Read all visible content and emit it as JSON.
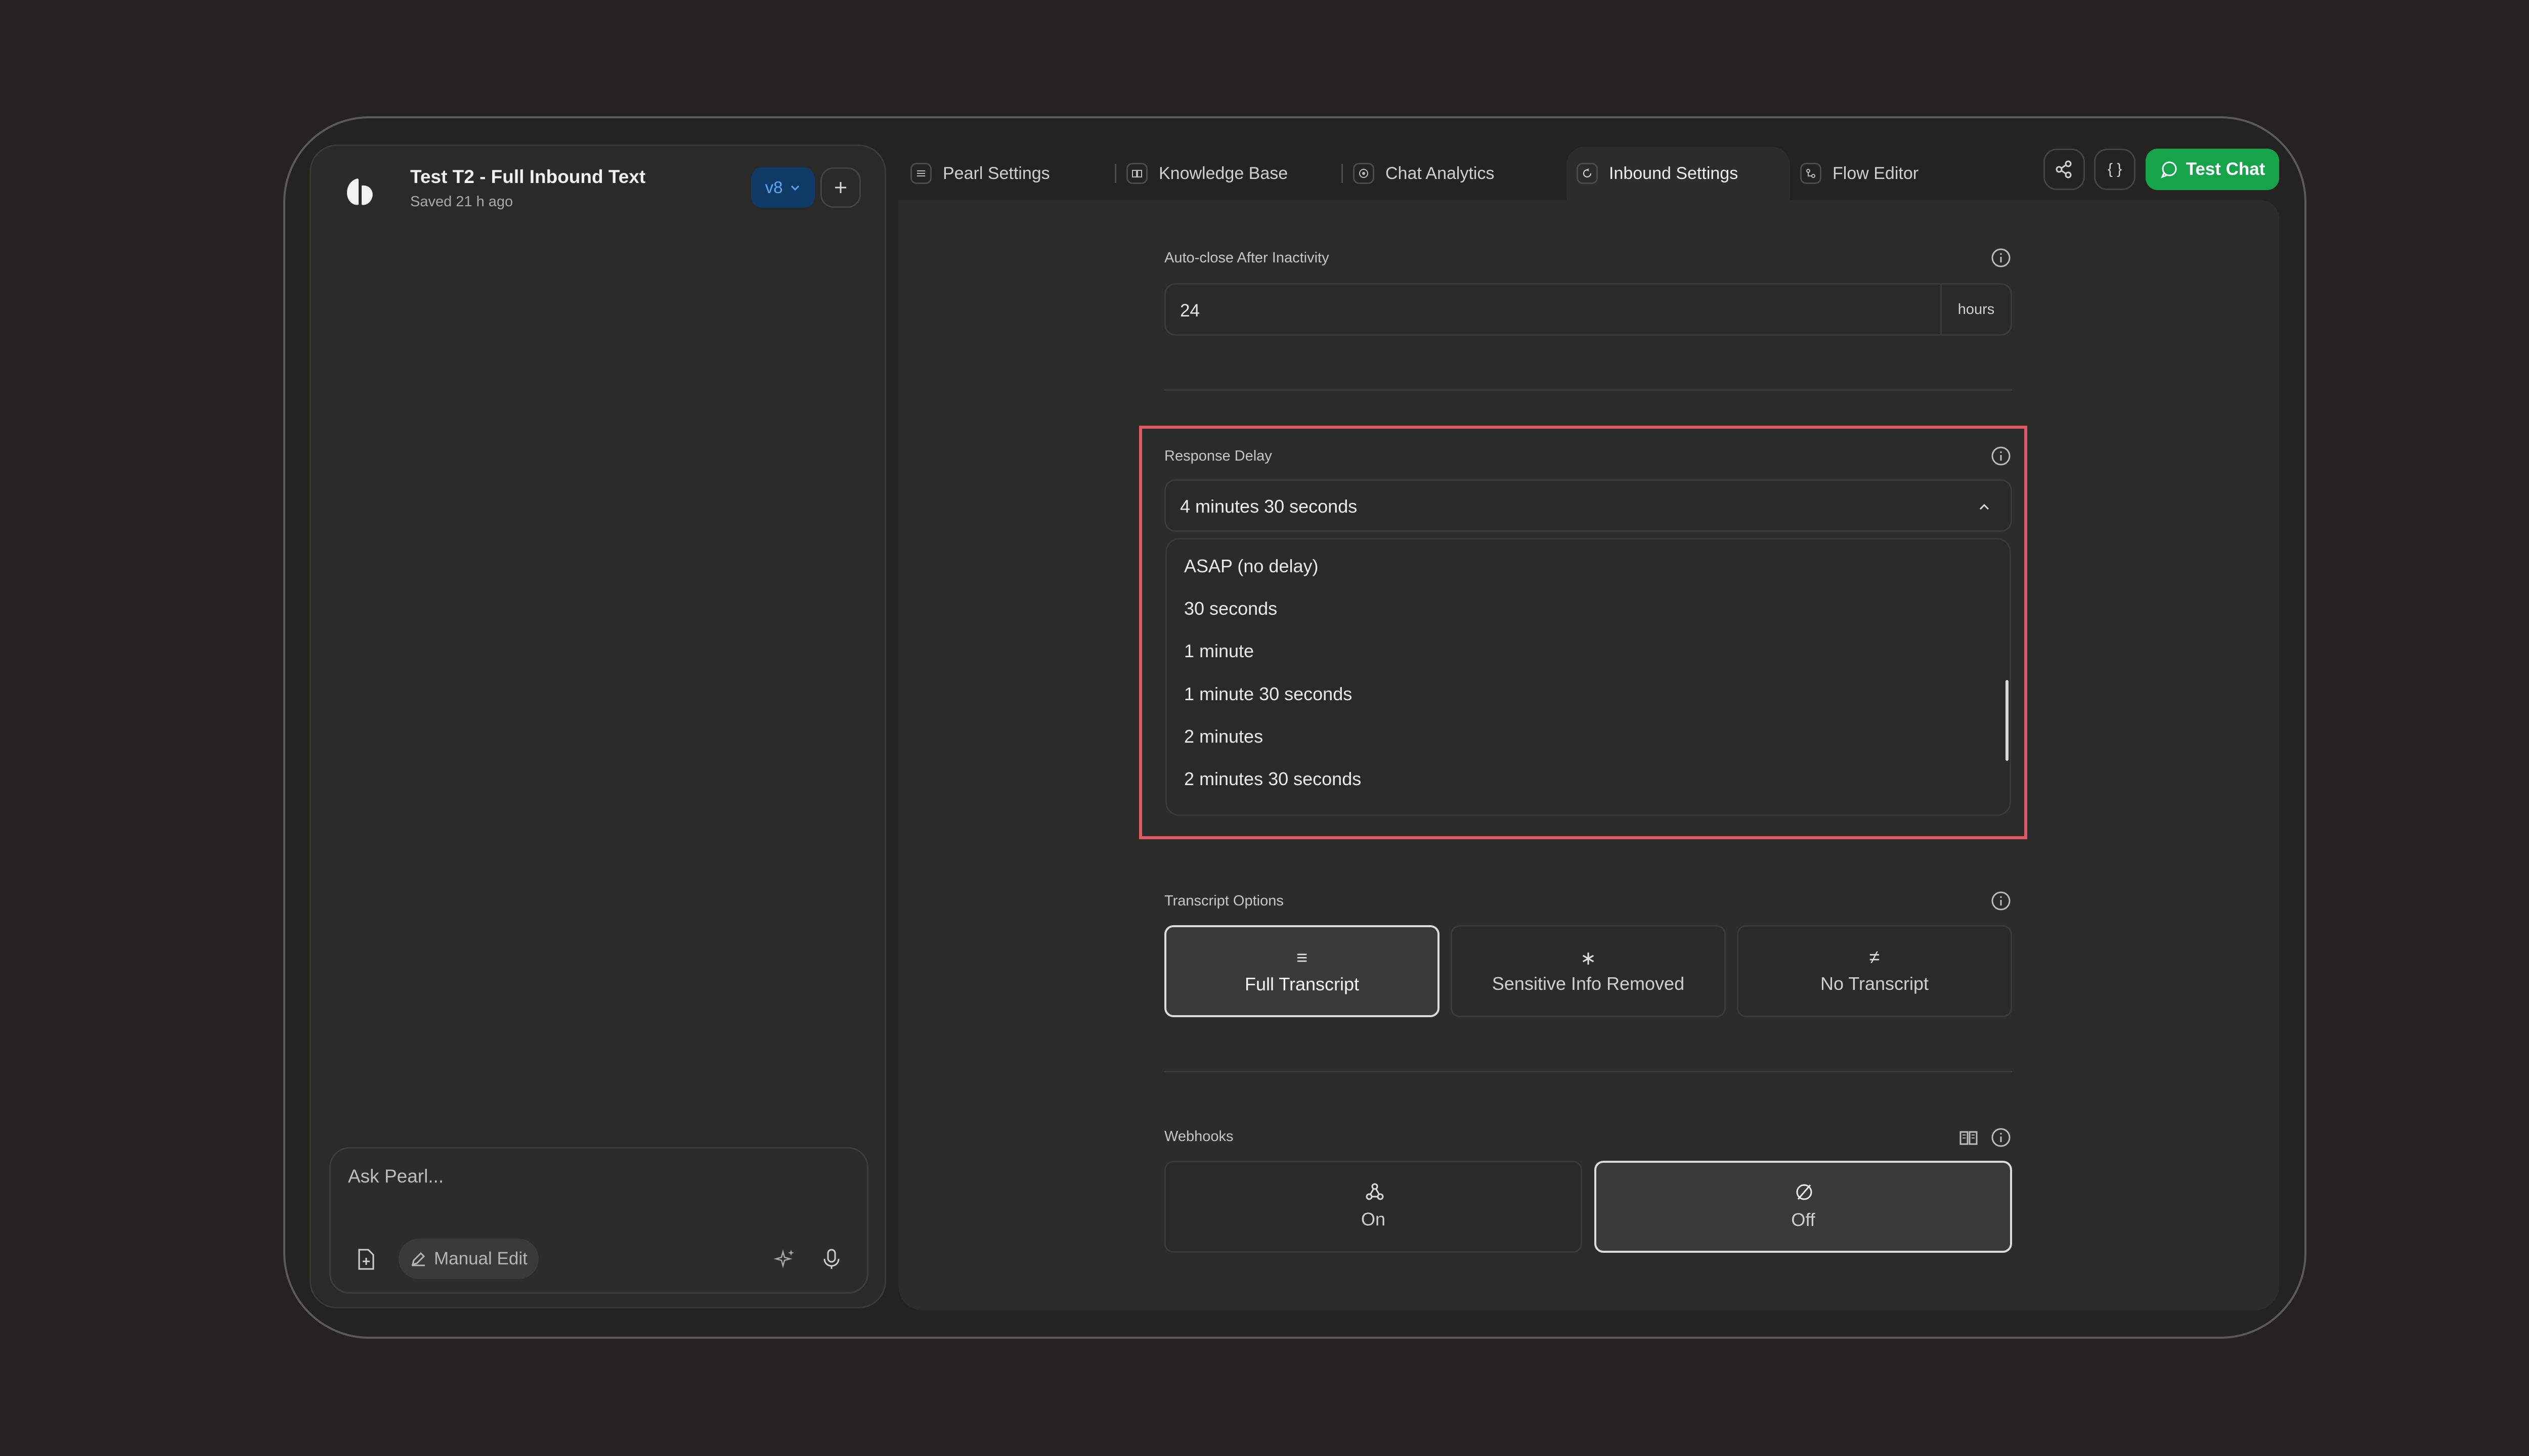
{
  "project": {
    "title": "Test T2 - Full Inbound Text",
    "saved": "Saved 21 h ago",
    "version": "v8"
  },
  "chat": {
    "placeholder": "Ask Pearl...",
    "manual_edit": "Manual Edit"
  },
  "tabs": [
    {
      "label": "Pearl Settings",
      "icon": "sliders-icon"
    },
    {
      "label": "Knowledge Base",
      "icon": "book-icon"
    },
    {
      "label": "Chat Analytics",
      "icon": "analytics-icon"
    },
    {
      "label": "Inbound Settings",
      "icon": "inbound-icon",
      "active": true
    },
    {
      "label": "Flow Editor",
      "icon": "flow-icon"
    }
  ],
  "toolbar": {
    "test_chat": "Test Chat",
    "code_label": "{ }"
  },
  "auto_close": {
    "label": "Auto-close After Inactivity",
    "value": "24",
    "unit": "hours"
  },
  "response_delay": {
    "label": "Response Delay",
    "selected": "4 minutes 30 seconds",
    "options": [
      "ASAP (no delay)",
      "30 seconds",
      "1 minute",
      "1 minute 30 seconds",
      "2 minutes",
      "2 minutes 30 seconds"
    ]
  },
  "transcript": {
    "label": "Transcript Options",
    "options": [
      {
        "label": "Full Transcript",
        "icon": "≡",
        "selected": true
      },
      {
        "label": "Sensitive Info Removed",
        "icon": "∗",
        "selected": false
      },
      {
        "label": "No Transcript",
        "icon": "≠",
        "selected": false
      }
    ]
  },
  "webhooks": {
    "label": "Webhooks",
    "options": [
      {
        "label": "On",
        "selected": false
      },
      {
        "label": "Off",
        "selected": true
      }
    ]
  },
  "colors": {
    "accent_green": "#17a34a",
    "highlight_red": "#e05a66",
    "version_blue": "#0f3a66"
  }
}
